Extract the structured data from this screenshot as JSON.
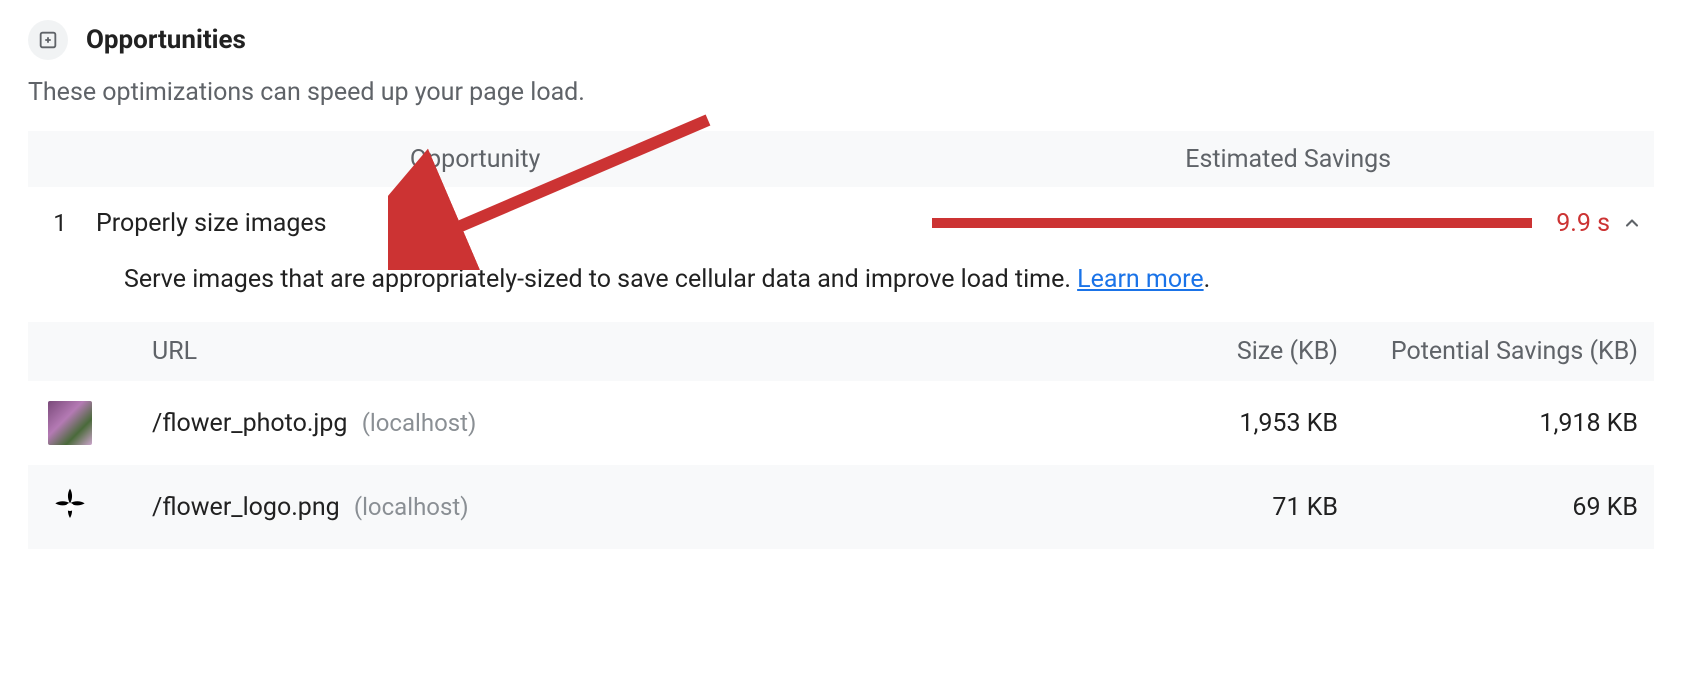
{
  "section": {
    "title": "Opportunities",
    "subtitle": "These optimizations can speed up your page load."
  },
  "columns": {
    "opportunity": "Opportunity",
    "savings": "Estimated Savings"
  },
  "opportunity": {
    "index": "1",
    "title": "Properly size images",
    "time": "9.9 s",
    "description_pre": "Serve images that are appropriately-sized to save cellular data and improve load time. ",
    "learn_more": "Learn more",
    "description_post": "."
  },
  "detail": {
    "headers": {
      "url": "URL",
      "size": "Size (KB)",
      "savings": "Potential Savings (KB)"
    },
    "rows": [
      {
        "path": "/flower_photo.jpg",
        "host": "(localhost)",
        "size": "1,953 KB",
        "savings": "1,918 KB",
        "thumb": "photo"
      },
      {
        "path": "/flower_logo.png",
        "host": "(localhost)",
        "size": "71 KB",
        "savings": "69 KB",
        "thumb": "logo"
      }
    ]
  }
}
